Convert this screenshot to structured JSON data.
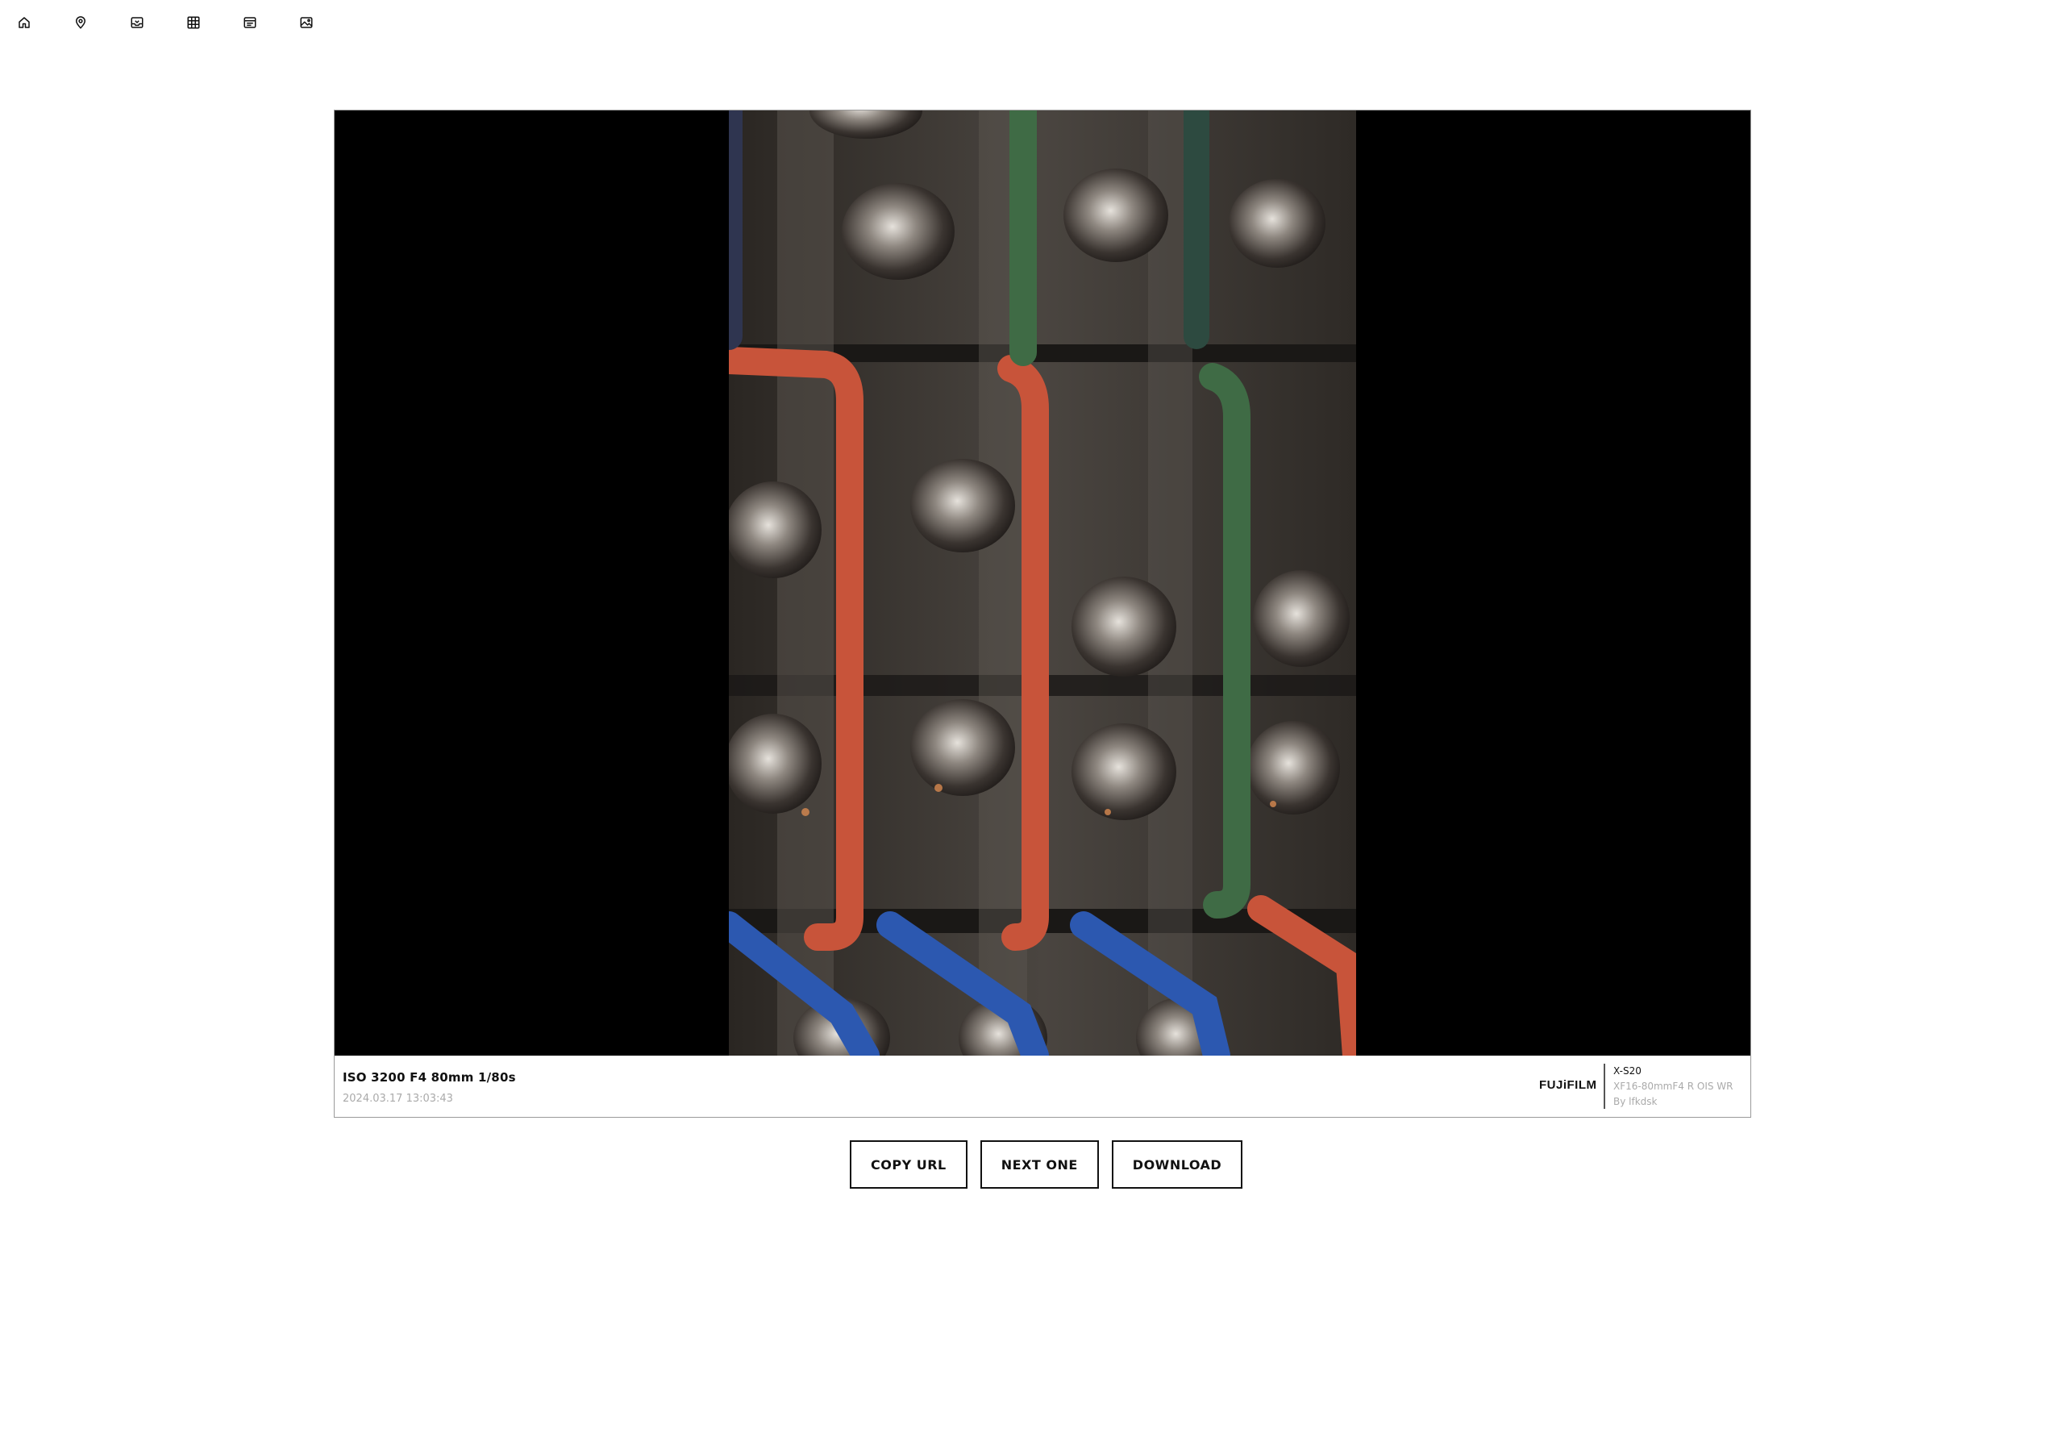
{
  "nav": {
    "items": [
      {
        "icon": "home-icon"
      },
      {
        "icon": "map-pin-icon"
      },
      {
        "icon": "inbox-icon"
      },
      {
        "icon": "grid-icon"
      },
      {
        "icon": "list-icon"
      },
      {
        "icon": "image-icon"
      }
    ]
  },
  "photo": {
    "exif": "ISO 3200 F4 80mm 1/80s",
    "datetime": "2024.03.17 13:03:43",
    "brand": "FUJiFILM",
    "camera_model": "X-S20",
    "lens": "XF16-80mmF4 R OIS WR",
    "author": "By lfkdsk"
  },
  "actions": {
    "copy_url": "COPY URL",
    "next_one": "NEXT ONE",
    "download": "DOWNLOAD"
  },
  "colors": {
    "background": "#ffffff",
    "stage": "#000000",
    "text": "#111111",
    "muted": "#aaaaaa",
    "tube_strap_orange": "#c8543a",
    "tube_strap_green": "#3f6b45",
    "tube_strap_blue": "#2c58b0"
  }
}
